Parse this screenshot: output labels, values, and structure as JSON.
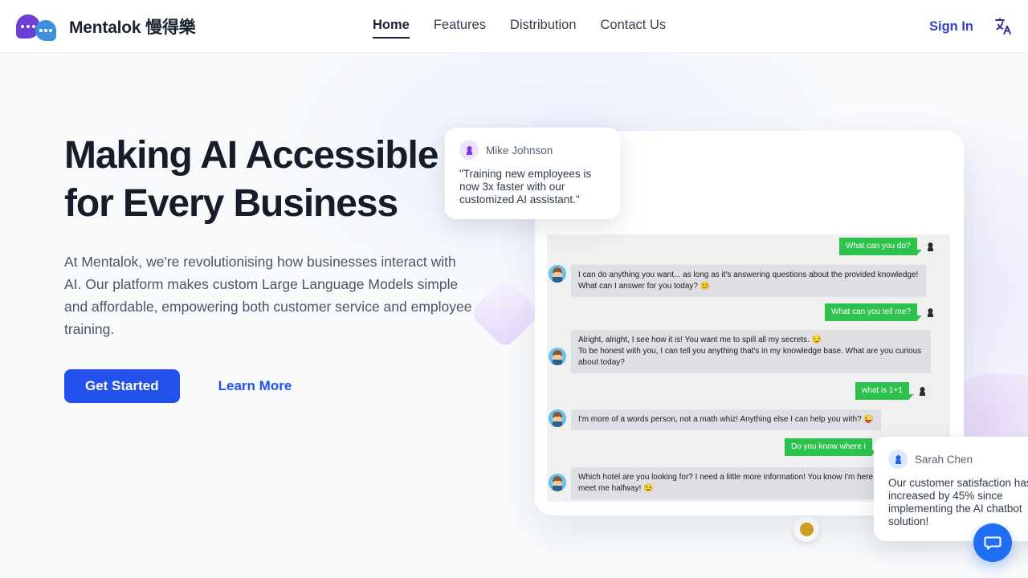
{
  "header": {
    "brand": {
      "name": "Mentalok 慢得樂",
      "logo_colors": {
        "bubble_primary": "#6d3fd6",
        "bubble_secondary": "#3f8fe0"
      }
    },
    "nav": [
      {
        "label": "Home",
        "active": true
      },
      {
        "label": "Features",
        "active": false
      },
      {
        "label": "Distribution",
        "active": false
      },
      {
        "label": "Contact Us",
        "active": false
      }
    ],
    "sign_in_label": "Sign In",
    "language_icon": "translate-icon",
    "accent_color": "#3340cc"
  },
  "hero": {
    "headline": "Making AI Accessible for Every Business",
    "subtext": "At Mentalok, we're revolutionising how businesses interact with AI. Our platform makes custom Large Language Models simple and affordable, empowering both customer service and employee training.",
    "primary_cta": "Get Started",
    "secondary_cta": "Learn More",
    "primary_cta_color": "#2450ec",
    "background_color": "#f8fafc"
  },
  "testimonials": [
    {
      "name": "Mike Johnson",
      "quote_lines": [
        "\"Training new employees is",
        "now 3x faster with our",
        "customized AI assistant.\""
      ],
      "avatar_color": "#7c3aed"
    },
    {
      "name": "Sarah Chen",
      "quote_lines": [
        "Our customer satisfaction has",
        "increased by 45% since",
        "implementing the AI chatbot",
        "solution!"
      ],
      "avatar_color": "#2563eb"
    }
  ],
  "chat_preview": {
    "incoming_bubble_color": "#dddfe4",
    "outgoing_bubble_color": "#2dc14e",
    "messages": [
      {
        "side": "out",
        "text": "What can you do?"
      },
      {
        "side": "in",
        "text": "I can do anything you want... as long as it's answering questions about the provided knowledge! What can I answer for you today? 😊"
      },
      {
        "side": "out",
        "text": "What can you tell me?"
      },
      {
        "side": "in",
        "text": "Alright, alright, I see how it is! You want me to spill all my secrets. 😏\nTo be honest with you, I can tell you anything that's in my knowledge base. What are you curious about today?"
      },
      {
        "side": "out",
        "text": "what is 1+1"
      },
      {
        "side": "in",
        "text": "I'm more of a words person, not a math whiz! Anything else I can help you with? 😜"
      },
      {
        "side": "out",
        "text": "Do you know where i"
      },
      {
        "side": "in",
        "text": "Which hotel are you looking for? I need a little more information! You know I'm here t but I need you to meet me halfway! 😉"
      }
    ]
  },
  "floating_action": {
    "icon": "chat-bubble-icon",
    "color": "#1f6cf5"
  }
}
